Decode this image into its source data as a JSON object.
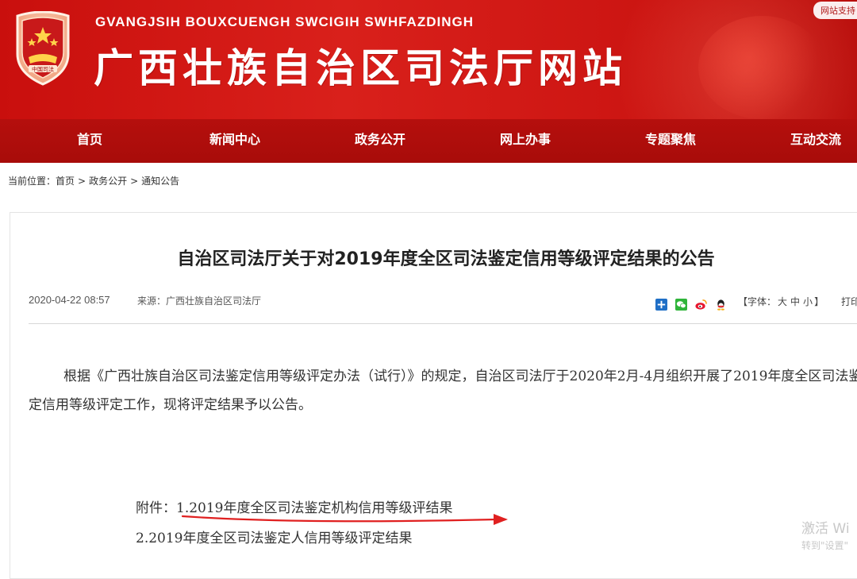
{
  "header": {
    "latin_name": "GVANGJSIH BOUXCUENGH SWCIGIH SWHFAZDINGH",
    "site_title": "广西壮族自治区司法厅网站",
    "emblem_text": "中国司法",
    "top_badge": "网站支持",
    "brand_red": "#c90f0d"
  },
  "nav": {
    "items": [
      {
        "label": "首页"
      },
      {
        "label": "新闻中心"
      },
      {
        "label": "政务公开"
      },
      {
        "label": "网上办事"
      },
      {
        "label": "专题聚焦"
      },
      {
        "label": "互动交流"
      }
    ]
  },
  "breadcrumb": {
    "prefix": "当前位置：",
    "items": [
      "首页",
      "政务公开",
      "通知公告"
    ],
    "separator": ">"
  },
  "article": {
    "title": "自治区司法厅关于对2019年度全区司法鉴定信用等级评定结果的公告",
    "date": "2020-04-22 08:57",
    "source": "来源：广西壮族自治区司法厅",
    "share_icons": [
      "share-plus-icon",
      "wechat-icon",
      "weibo-icon",
      "qq-icon"
    ],
    "font_size": {
      "open": "【字体：",
      "large": "大",
      "medium": "中",
      "small": "小",
      "close": "】"
    },
    "print": "打印",
    "body": "根据《广西壮族自治区司法鉴定信用等级评定办法（试行）》的规定，自治区司法厅于2020年2月-4月组织开展了2019年度全区司法鉴定信用等级评定工作，现将评定结果予以公告。",
    "attachment_prefix": "附件：",
    "attachments": [
      "1.2019年度全区司法鉴定机构信用等级评结果",
      "2.2019年度全区司法鉴定人信用等级评定结果"
    ],
    "annotation_color": "#e02020"
  },
  "watermark": {
    "line1": "激活 Wi",
    "line2": "转到\"设置\""
  }
}
